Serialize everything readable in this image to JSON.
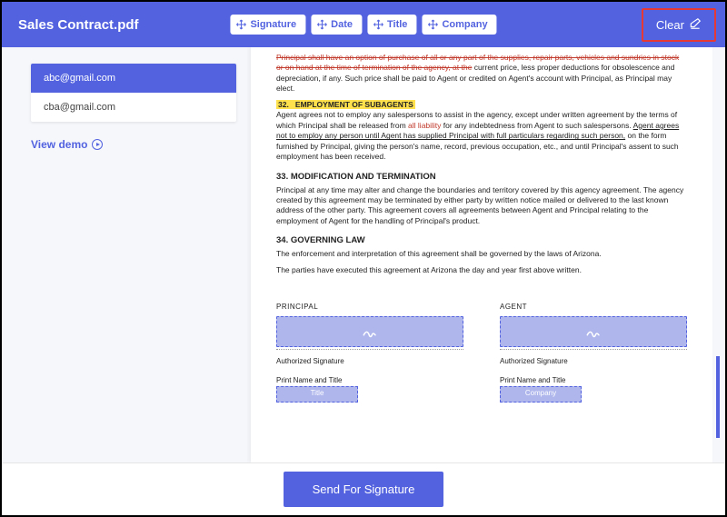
{
  "header": {
    "title": "Sales Contract.pdf",
    "fields": [
      {
        "label": "Signature"
      },
      {
        "label": "Date"
      },
      {
        "label": "Title"
      },
      {
        "label": "Company"
      }
    ],
    "clear": "Clear"
  },
  "sidebar": {
    "emails": [
      {
        "address": "abc@gmail.com",
        "selected": true
      },
      {
        "address": "cba@gmail.com",
        "selected": false
      }
    ],
    "view_demo": "View demo"
  },
  "document": {
    "intro_strike": "Principal shall have an option of purchase of all or any part of the supplies, repair parts, vehicles and sundries in stock or on hand at the time of termination of the agency, at the",
    "intro_rest": "current price, less proper deductions for obsolescence and depreciation, if any. Such price shall be paid to Agent or credited on Agent's account with Principal, as Principal may elect.",
    "sec32_num": "32.",
    "sec32_title": "EMPLOYMENT OF SUBAGENTS",
    "sec32_body_a": "Agent agrees not to employ any salespersons to assist in the agency, except under written agreement by the terms of which Principal shall be released from ",
    "sec32_red": "all liability",
    "sec32_body_b": " for any indebtedness from Agent to such salespersons. ",
    "sec32_u": "Agent agrees not to employ any person until Agent has supplied Principal with full particulars regarding such person,",
    "sec32_body_c": " on the form furnished by Principal, giving the person's name, record, previous occupation, etc., and until Principal's assent to such employment has been received.",
    "sec33_title": "33.   MODIFICATION AND TERMINATION",
    "sec33_body": "Principal at any time may alter and change the boundaries and territory covered by this agency agreement. The agency created by this agreement may be terminated by either party by written notice mailed or delivered to the last known address of the other party. This agreement covers all agreements between Agent and Principal relating to the employment of Agent for the handling of Principal's product.",
    "sec34_title": "34.   GOVERNING LAW",
    "sec34_body1": "The enforcement and interpretation of this agreement shall be governed by the laws of Arizona.",
    "sec34_body2": "The parties have executed this agreement at Arizona the day and year first above written.",
    "principal": "PRINCIPAL",
    "agent": "AGENT",
    "authorized": "Authorized Signature",
    "print_name": "Print Name and Title",
    "title_field": "Title",
    "company_field": "Company"
  },
  "footer": {
    "send": "Send For Signature"
  }
}
